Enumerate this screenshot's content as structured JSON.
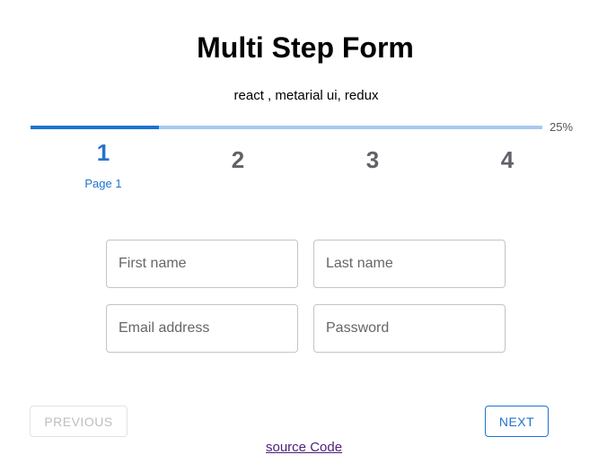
{
  "header": {
    "title": "Multi Step Form",
    "subtitle": "react , metarial ui, redux"
  },
  "progress": {
    "percent": 25,
    "label": "25%",
    "fill_color": "#1e73cf",
    "track_color": "#a8c9ee"
  },
  "steps": [
    {
      "number": "1",
      "label": "Page 1",
      "active": true
    },
    {
      "number": "2",
      "label": "",
      "active": false
    },
    {
      "number": "3",
      "label": "",
      "active": false
    },
    {
      "number": "4",
      "label": "",
      "active": false
    }
  ],
  "form": {
    "first_name": {
      "value": "",
      "placeholder": "First name"
    },
    "last_name": {
      "value": "",
      "placeholder": "Last name"
    },
    "email": {
      "value": "",
      "placeholder": "Email address"
    },
    "password": {
      "value": "",
      "placeholder": "Password"
    }
  },
  "buttons": {
    "previous": "PREVIOUS",
    "next": "NEXT"
  },
  "footer": {
    "source_link": "source Code"
  },
  "colors": {
    "accent": "#1e73cf",
    "disabled_text": "#bdbdbd",
    "link_visited": "#4b1f7a"
  }
}
